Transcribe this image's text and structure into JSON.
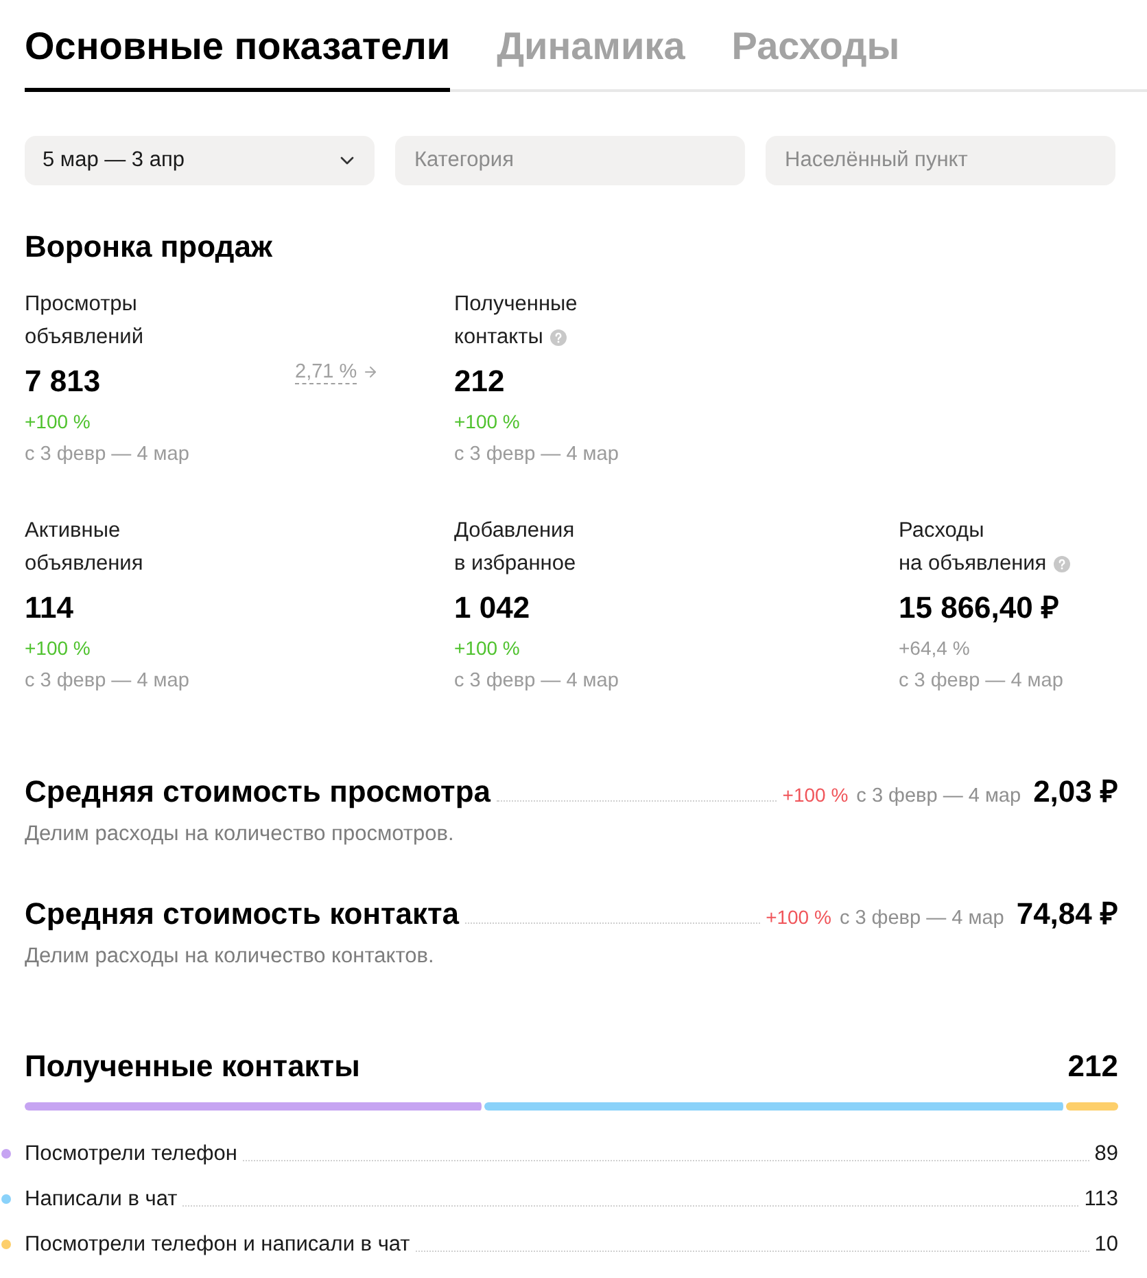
{
  "tabs": [
    {
      "label": "Основные показатели",
      "selected": true
    },
    {
      "label": "Динамика",
      "selected": false
    },
    {
      "label": "Расходы",
      "selected": false
    }
  ],
  "filters": [
    {
      "kind": "select",
      "value": "5 мар — 3 апр"
    },
    {
      "kind": "input",
      "placeholder": "Категория"
    },
    {
      "kind": "input",
      "placeholder": "Населённый пункт"
    }
  ],
  "funnel": {
    "title": "Воронка продаж",
    "rows": [
      {
        "conversion": "2,71 %",
        "metrics": [
          {
            "label_lines": [
              "Просмотры",
              "объявлений"
            ],
            "help": false,
            "value": "7 813",
            "change": {
              "text": "+100 %",
              "kind": "good"
            },
            "period": "с 3 февр — 4 мар"
          },
          {
            "label_lines": [
              "Полученные",
              "контакты"
            ],
            "help": true,
            "value": "212",
            "change": {
              "text": "+100 %",
              "kind": "good"
            },
            "period": "с 3 февр — 4 мар"
          }
        ]
      },
      {
        "metrics": [
          {
            "label_lines": [
              "Активные",
              "объявления"
            ],
            "help": false,
            "value": "114",
            "change": {
              "text": "+100 %",
              "kind": "good"
            },
            "period": "с 3 февр — 4 мар"
          },
          {
            "label_lines": [
              "Добавления",
              "в избранное"
            ],
            "help": false,
            "value": "1 042",
            "change": {
              "text": "+100 %",
              "kind": "good"
            },
            "period": "с 3 февр — 4 мар"
          },
          {
            "label_lines": [
              "Расходы",
              "на объявления"
            ],
            "help": true,
            "value": "15 866,40 ₽",
            "change": {
              "text": "+64,4 %",
              "kind": "neutral"
            },
            "period": "с 3 февр — 4 мар"
          }
        ]
      }
    ]
  },
  "costs": [
    {
      "title": "Средняя стоимость просмотра",
      "change": {
        "text": "+100 %",
        "kind": "bad"
      },
      "period": "с 3 февр — 4 мар",
      "value": "2,03 ₽",
      "description": "Делим расходы на количество просмотров."
    },
    {
      "title": "Средняя стоимость контакта",
      "change": {
        "text": "+100 %",
        "kind": "bad"
      },
      "period": "с 3 февр — 4 мар",
      "value": "74,84 ₽",
      "description": "Делим расходы на количество контактов."
    }
  ],
  "contacts": {
    "title": "Полученные контакты",
    "total": "212",
    "items": [
      {
        "label": "Посмотрели телефон",
        "value": "89",
        "color": "#c6a4f2"
      },
      {
        "label": "Написали в чат",
        "value": "113",
        "color": "#8ad2fa"
      },
      {
        "label": "Посмотрели телефон и написали в чат",
        "value": "10",
        "color": "#fdcf6b"
      }
    ]
  }
}
